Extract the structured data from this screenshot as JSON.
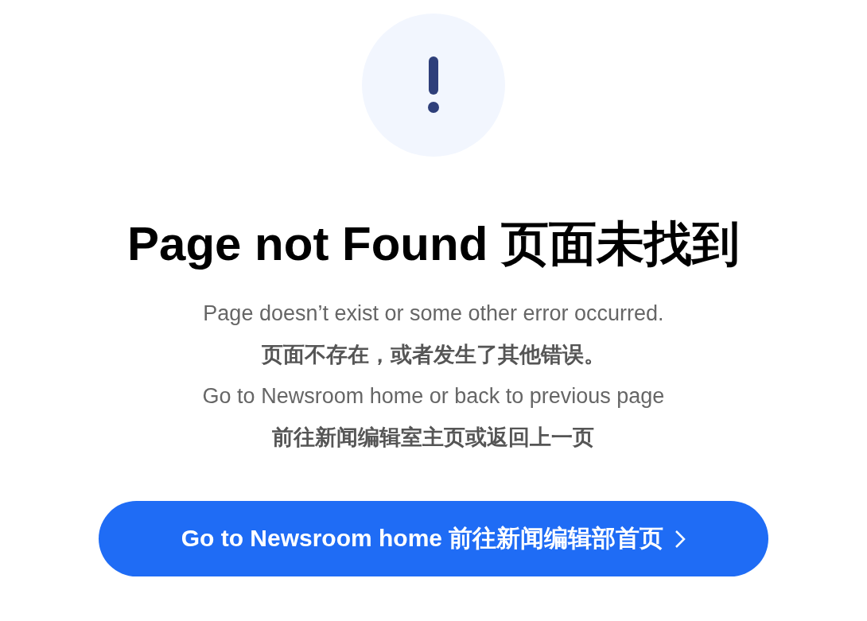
{
  "title": "Page not Found  页面未找到",
  "messages": [
    "Page doesn’t exist or some other error occurred.",
    "页面不存在，或者发生了其他错误。",
    "Go to Newsroom home or back to previous page",
    "前往新闻编辑室主页或返回上一页"
  ],
  "button": {
    "label": "Go to Newsroom home  前往新闻编辑部首页"
  }
}
